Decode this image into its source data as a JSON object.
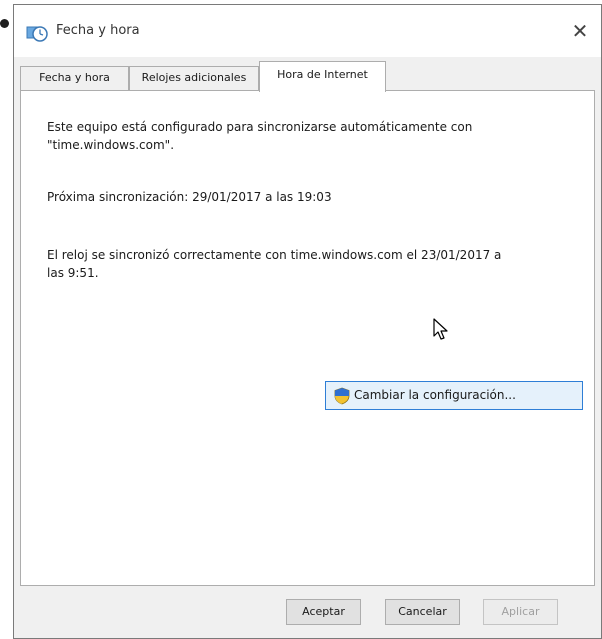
{
  "window": {
    "title": "Fecha y hora"
  },
  "tabs": [
    {
      "label": "Fecha y hora"
    },
    {
      "label": "Relojes adicionales"
    },
    {
      "label": "Hora de Internet"
    }
  ],
  "panel": {
    "sync_line1": "Este equipo está configurado para sincronizarse automáticamente con",
    "sync_line2": "\"time.windows.com\".",
    "next_sync": "Próxima sincronización: 29/01/2017 a las 19:03",
    "last_sync_line1": "El reloj se sincronizó correctamente con time.windows.com el 23/01/2017 a",
    "last_sync_line2": "las 9:51.",
    "change_button": "Cambiar la configuración..."
  },
  "buttons": {
    "ok": "Aceptar",
    "cancel": "Cancelar",
    "apply": "Aplicar"
  },
  "icons": {
    "title": "clock-icon",
    "change": "uac-shield-icon",
    "cursor": "mouse-pointer-icon"
  },
  "colors": {
    "accent": "#2e7ed6",
    "button_hover_bg": "#e5f1fb"
  }
}
